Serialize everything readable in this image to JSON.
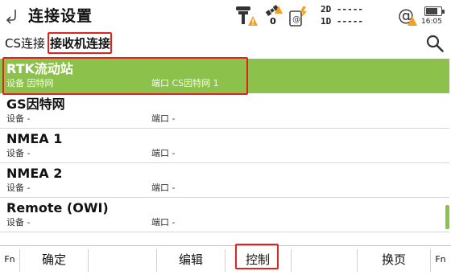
{
  "title_bar": {
    "back_icon": "back-arrow-icon",
    "title": "连接设置",
    "status": {
      "antenna_icon": "receiver-antenna-warning-icon",
      "satellite_icon": "satellite-icon",
      "satellite_count": "0",
      "radio_icon": "radio-link-icon",
      "position_2d": "2D -----",
      "position_1d": "1D -----",
      "at_icon": "at-warning-icon",
      "battery_level": 0.85,
      "time": "16:05"
    }
  },
  "tabs": {
    "cs_connection": "CS连接",
    "receiver_connection": "接收机连接",
    "search_icon": "search-icon"
  },
  "connections": [
    {
      "name": "RTK流动站",
      "device": "设备  因特网",
      "port": "端口  CS因特网 1",
      "selected": true
    },
    {
      "name": "GS因特网",
      "device": "设备  -",
      "port": "端口  -",
      "selected": false
    },
    {
      "name": "NMEA 1",
      "device": "设备  -",
      "port": "端口  -",
      "selected": false
    },
    {
      "name": "NMEA 2",
      "device": "设备  -",
      "port": "端口  -",
      "selected": false
    },
    {
      "name": "Remote (OWI)",
      "device": "设备  -",
      "port": "端口  -",
      "selected": false
    }
  ],
  "function_keys": {
    "fn_left": "Fn",
    "ok": "确定",
    "edit": "编辑",
    "control": "控制",
    "next_page": "换页",
    "fn_right": "Fn"
  },
  "colors": {
    "selected_row": "#8cc24b",
    "highlight": "#e0231b",
    "warning": "#f2a024"
  }
}
